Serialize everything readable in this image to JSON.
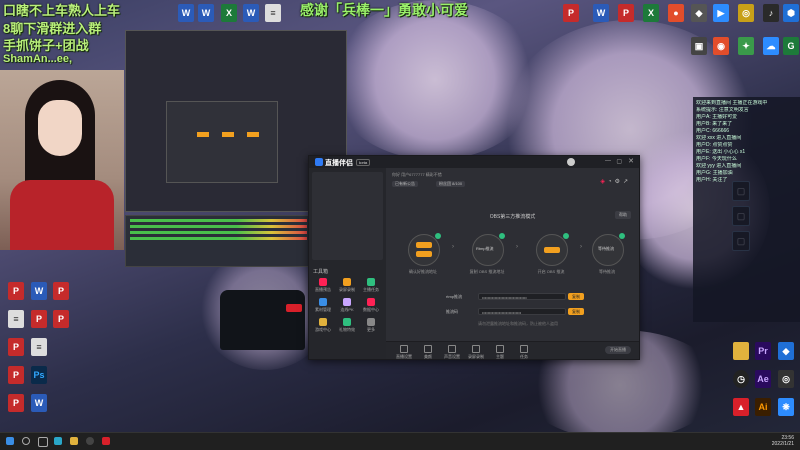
{
  "overlay": {
    "line1": "口瞎不上车熟人上车",
    "line2": "感谢「兵棒一」勇敢小可爱",
    "line3": "8聊下滑群进入群",
    "line4": "手抓饼子+团战 ",
    "line5": "ShamAn...ee,"
  },
  "app": {
    "name": "直播伴侣",
    "badge": "beta",
    "breadcrumb": "你好 用户6777777 精彩不错",
    "tag_active": "已有新公告",
    "tag_other": "粉丝团 8/100",
    "section_title": "OBS第三方推流模式",
    "help_button": "帮助",
    "steps": [
      {
        "label": "确认好推流地址",
        "sub": "推流地址"
      },
      {
        "label": "复制 OBS 推流地址",
        "sub": "Rtmp推流"
      },
      {
        "label": "开启 OBS 推流",
        "sub": "开始推流"
      },
      {
        "label": "等待推流",
        "sub": "等待推流"
      }
    ],
    "stream_url_label": "rtmp推流",
    "stream_url_value": "••••••••••••••••••••••••••••••••",
    "stream_key_label": "推流码",
    "stream_key_value": "••••••••••••••••••••••••••••",
    "copy_label": "复制",
    "hint": "请勿泄露推流地址和推流码，防止被他人盗用",
    "side_section": "工具箱",
    "side_items": [
      "直播预告",
      "录屏录制",
      "主播任务",
      "素材管理",
      "连线PK",
      "数据中心",
      "游戏中心",
      "礼物特效",
      "更多"
    ],
    "bottom_items": [
      "直播设置",
      "美颜",
      "声音设置",
      "录屏录制",
      "主题",
      "任务"
    ],
    "start_button": "开始直播"
  },
  "chat": {
    "lines": [
      "欢迎来到直播间 主播正在游戏中",
      "系统提示: 注意文明发言",
      "用户A: 主播好可爱",
      "用户B: 来了来了",
      "用户C: 666666",
      "欢迎 xxx 进入直播间",
      "用户D: 点赞点赞",
      "用户E: 送出 小心心 x1",
      "用户F: 今天玩什么",
      "欢迎 yyy 进入直播间",
      "用户G: 主播加油",
      "用户H: 关注了"
    ]
  },
  "taskbar": {
    "time": "23:56",
    "date": "2022/1/21"
  },
  "desktop_icons": [
    {
      "name": "word-icon",
      "color": "#2b5bb8",
      "glyph": "W"
    },
    {
      "name": "pdf-icon",
      "color": "#c52b2b",
      "glyph": "P"
    },
    {
      "name": "excel-icon",
      "color": "#1d7a3a",
      "glyph": "X"
    },
    {
      "name": "zoom-icon",
      "color": "#2d8cff",
      "glyph": "Z"
    },
    {
      "name": "folder-icon",
      "color": "#e1b23d",
      "glyph": ""
    },
    {
      "name": "premiere-icon",
      "color": "#2a0a5e",
      "glyph": "Pr"
    },
    {
      "name": "after-effects-icon",
      "color": "#2a0a5e",
      "glyph": "Ae"
    },
    {
      "name": "illustrator-icon",
      "color": "#3a1e00",
      "glyph": "Ai"
    },
    {
      "name": "photoshop-icon",
      "color": "#0a2a4a",
      "glyph": "Ps"
    }
  ]
}
